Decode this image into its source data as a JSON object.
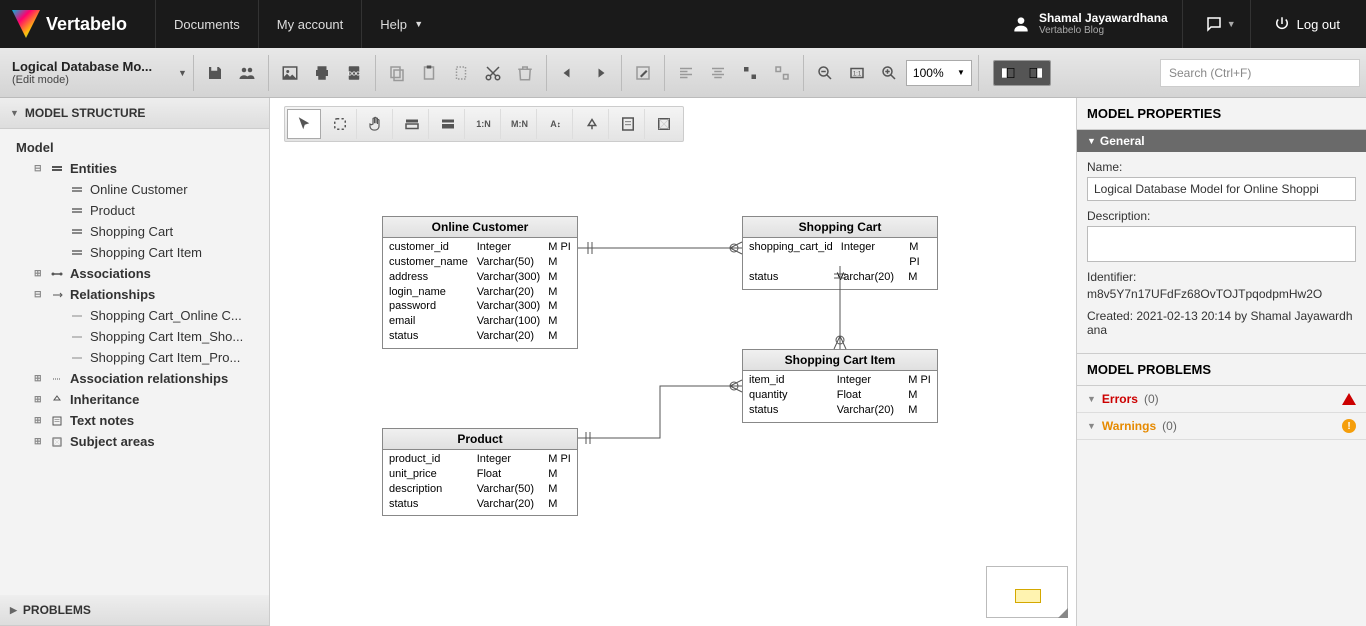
{
  "header": {
    "brand": "Vertabelo",
    "nav": {
      "documents": "Documents",
      "account": "My account",
      "help": "Help"
    },
    "user": {
      "name": "Shamal Jayawardhana",
      "sub": "Vertabelo Blog"
    },
    "logout": "Log out"
  },
  "toolbar": {
    "model_title": "Logical Database Mo...",
    "model_mode": "(Edit mode)",
    "zoom": "100%",
    "search_placeholder": "Search (Ctrl+F)"
  },
  "left": {
    "structure_title": "MODEL STRUCTURE",
    "root": "Model",
    "entities_label": "Entities",
    "entities": {
      "e0": "Online Customer",
      "e1": "Product",
      "e2": "Shopping Cart",
      "e3": "Shopping Cart Item"
    },
    "associations": "Associations",
    "relationships_label": "Relationships",
    "relationships": {
      "r0": "Shopping Cart_Online C...",
      "r1": "Shopping Cart Item_Sho...",
      "r2": "Shopping Cart Item_Pro..."
    },
    "assoc_rel": "Association relationships",
    "inheritance": "Inheritance",
    "text_notes": "Text notes",
    "subject_areas": "Subject areas",
    "problems_title": "PROBLEMS"
  },
  "canvas": {
    "tools": {
      "one_n": "1:N",
      "m_n": "M:N",
      "a_up": "A"
    },
    "entities": {
      "online_customer": {
        "title": "Online Customer",
        "cols": [
          {
            "n": "customer_id",
            "t": "Integer",
            "f": "M PI"
          },
          {
            "n": "customer_name",
            "t": "Varchar(50)",
            "f": "M"
          },
          {
            "n": "address",
            "t": "Varchar(300)",
            "f": "M"
          },
          {
            "n": "login_name",
            "t": "Varchar(20)",
            "f": "M"
          },
          {
            "n": "password",
            "t": "Varchar(300)",
            "f": "M"
          },
          {
            "n": "email",
            "t": "Varchar(100)",
            "f": "M"
          },
          {
            "n": "status",
            "t": "Varchar(20)",
            "f": "M"
          }
        ]
      },
      "shopping_cart": {
        "title": "Shopping Cart",
        "cols": [
          {
            "n": "shopping_cart_id",
            "t": "Integer",
            "f": "M PI"
          },
          {
            "n": "status",
            "t": "Varchar(20)",
            "f": "M"
          }
        ]
      },
      "shopping_cart_item": {
        "title": "Shopping Cart Item",
        "cols": [
          {
            "n": "item_id",
            "t": "Integer",
            "f": "M PI"
          },
          {
            "n": "quantity",
            "t": "Float",
            "f": "M"
          },
          {
            "n": "status",
            "t": "Varchar(20)",
            "f": "M"
          }
        ]
      },
      "product": {
        "title": "Product",
        "cols": [
          {
            "n": "product_id",
            "t": "Integer",
            "f": "M PI"
          },
          {
            "n": "unit_price",
            "t": "Float",
            "f": "M"
          },
          {
            "n": "description",
            "t": "Varchar(50)",
            "f": "M"
          },
          {
            "n": "status",
            "t": "Varchar(20)",
            "f": "M"
          }
        ]
      }
    }
  },
  "right": {
    "properties_title": "MODEL PROPERTIES",
    "general": "General",
    "name_label": "Name:",
    "name_value": "Logical Database Model for Online Shoppi",
    "desc_label": "Description:",
    "identifier_label": "Identifier:",
    "identifier_value": "m8v5Y7n17UFdFz68OvTOJTpqodpmHw2O",
    "created": "Created: 2021-02-13 20:14 by Shamal Jayawardhana",
    "problems_title": "MODEL PROBLEMS",
    "errors_label": "Errors",
    "errors_count": "(0)",
    "warnings_label": "Warnings",
    "warnings_count": "(0)"
  }
}
